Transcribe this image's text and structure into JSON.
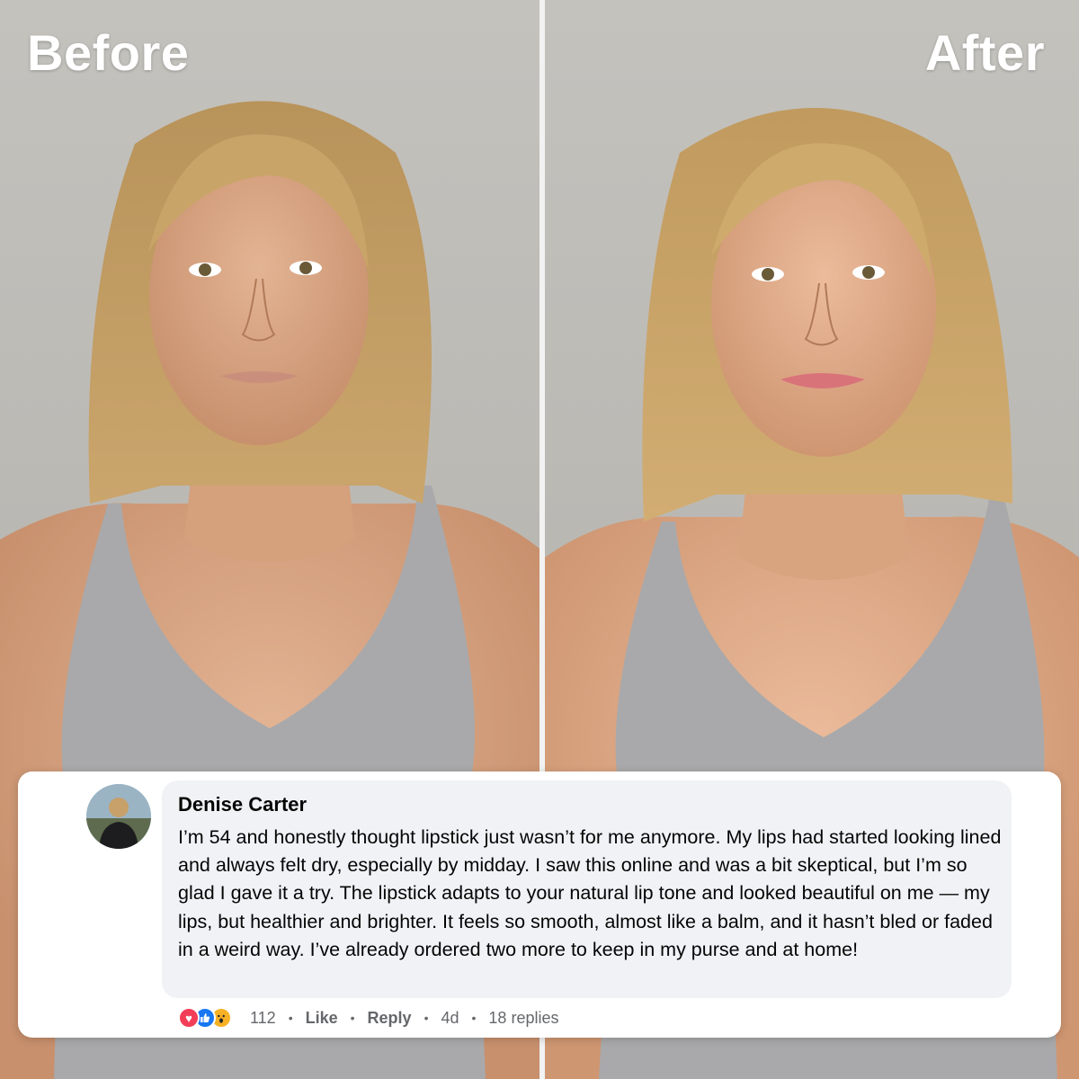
{
  "panels": {
    "before_label": "Before",
    "after_label": "After"
  },
  "comment": {
    "author": "Denise Carter",
    "text": "I’m 54 and honestly thought lipstick just wasn’t for me anymore. My lips had started looking lined and always felt dry, especially by midday. I saw this online and was a bit skeptical, but I’m so glad I gave it a try. The lipstick adapts to your natural lip tone and looked beautiful on me — my lips, but healthier and brighter. It feels so smooth, almost like a balm, and it hasn’t bled or faded in a weird way. I’ve already ordered two more to keep in my purse and at home!",
    "reactions": [
      "love-icon",
      "like-icon",
      "wow-icon"
    ],
    "reaction_count": "112",
    "like_label": "Like",
    "reply_label": "Reply",
    "age": "4d",
    "replies": "18 replies"
  },
  "colors": {
    "love": "#f33e58",
    "like": "#1877f2",
    "wow": "#f7b125",
    "bubble": "#f0f2f5"
  }
}
